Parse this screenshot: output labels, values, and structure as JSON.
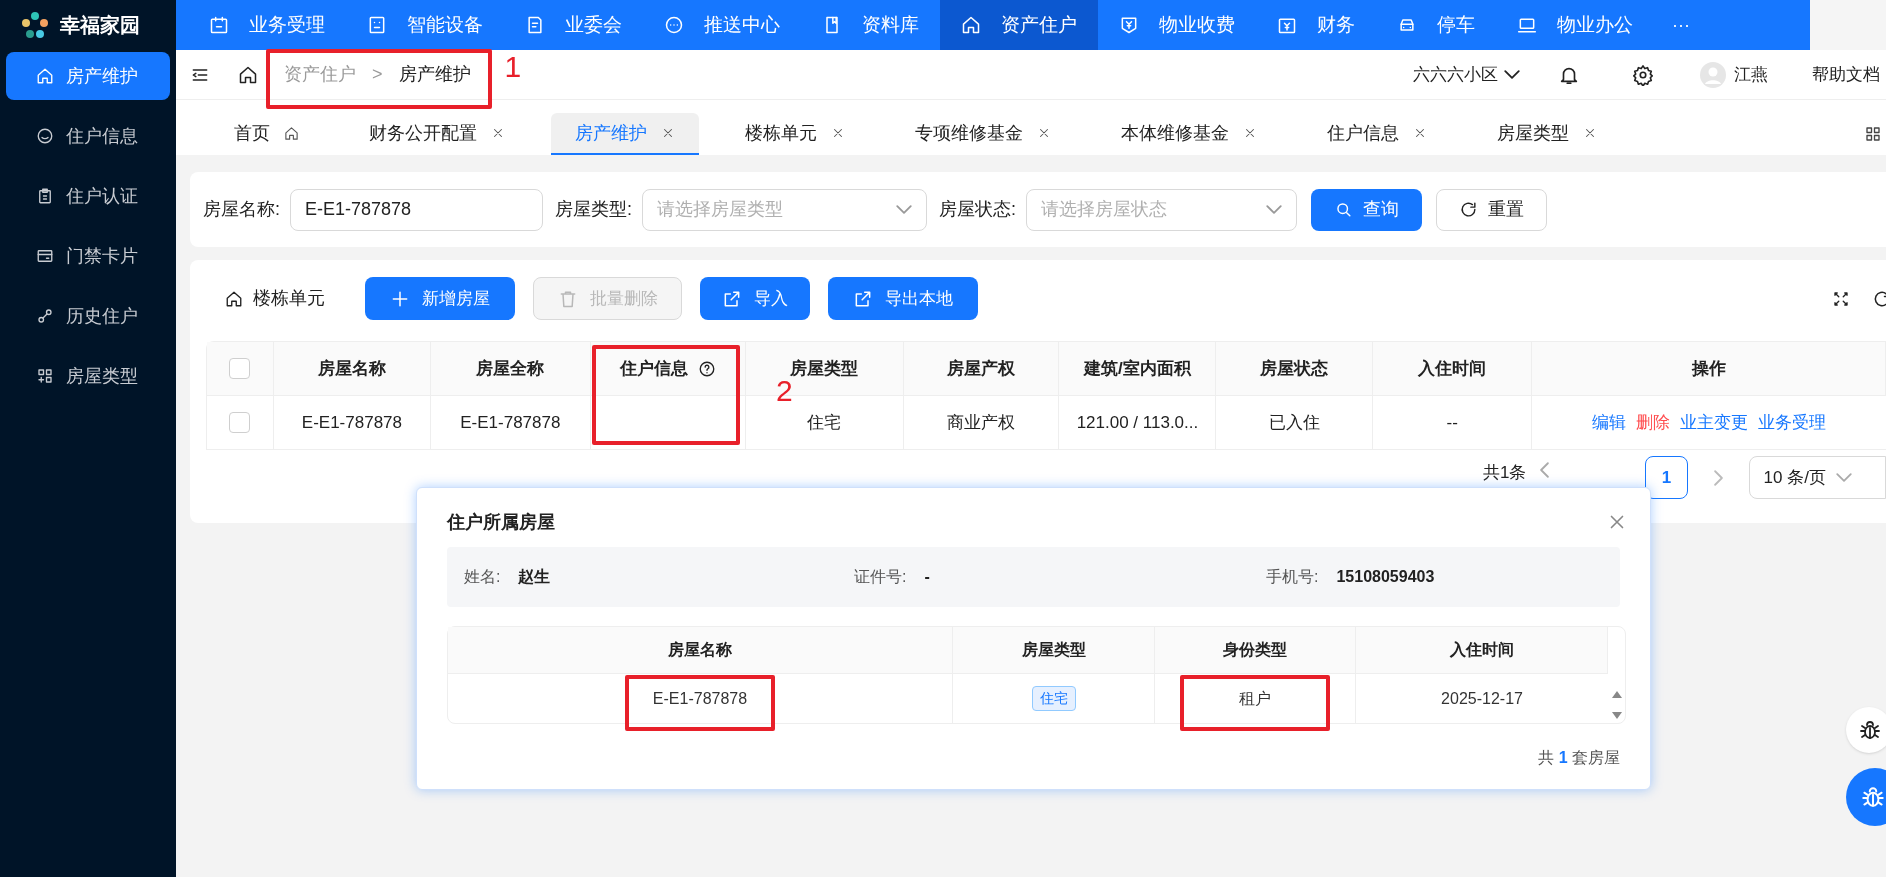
{
  "logo": {
    "text": "幸福家园"
  },
  "top_nav": [
    {
      "label": "业务受理",
      "selected": false
    },
    {
      "label": "智能设备",
      "selected": false
    },
    {
      "label": "业委会",
      "selected": false
    },
    {
      "label": "推送中心",
      "selected": false
    },
    {
      "label": "资料库",
      "selected": false
    },
    {
      "label": "资产住户",
      "selected": true
    },
    {
      "label": "物业收费",
      "selected": false
    },
    {
      "label": "财务",
      "selected": false
    },
    {
      "label": "停车",
      "selected": false
    },
    {
      "label": "物业办公",
      "selected": false
    }
  ],
  "top_nav_more": "···",
  "sidebar": {
    "items": [
      {
        "label": "房产维护",
        "selected": true
      },
      {
        "label": "住户信息",
        "selected": false
      },
      {
        "label": "住户认证",
        "selected": false
      },
      {
        "label": "门禁卡片",
        "selected": false
      },
      {
        "label": "历史住户",
        "selected": false
      },
      {
        "label": "房屋类型",
        "selected": false
      }
    ]
  },
  "header": {
    "breadcrumb": {
      "items": [
        "资产住户",
        "房产维护"
      ],
      "separator": ">",
      "highlighted": true,
      "annotation": "1"
    },
    "community": "六六六小区",
    "user_name": "江燕",
    "help": "帮助文档"
  },
  "tabs": [
    {
      "label": "首页",
      "kind": "home",
      "selected": false
    },
    {
      "label": "财务公开配置",
      "kind": "page",
      "selected": false
    },
    {
      "label": "房产维护",
      "kind": "page",
      "selected": true
    },
    {
      "label": "楼栋单元",
      "kind": "page",
      "selected": false
    },
    {
      "label": "专项维修基金",
      "kind": "page",
      "selected": false
    },
    {
      "label": "本体维修基金",
      "kind": "page",
      "selected": false
    },
    {
      "label": "住户信息",
      "kind": "page",
      "selected": false
    },
    {
      "label": "房屋类型",
      "kind": "page",
      "selected": false
    }
  ],
  "filters": [
    {
      "label": "房屋名称:",
      "kind": "input",
      "value": "E-E1-787878"
    },
    {
      "label": "房屋类型:",
      "kind": "select",
      "placeholder": "请选择房屋类型"
    },
    {
      "label": "房屋状态:",
      "kind": "select",
      "placeholder": "请选择房屋状态"
    }
  ],
  "filter_buttons": [
    {
      "label": "查询",
      "kind": "primary"
    },
    {
      "label": "重置",
      "kind": "default"
    }
  ],
  "toolbar": {
    "title": "楼栋单元",
    "buttons": [
      {
        "label": "新增房屋",
        "kind": "add",
        "disabled": false
      },
      {
        "label": "批量删除",
        "kind": "delete",
        "disabled": true
      },
      {
        "label": "导入",
        "kind": "import",
        "disabled": false
      },
      {
        "label": "导出本地",
        "kind": "export",
        "disabled": false
      }
    ]
  },
  "table": {
    "select_all_checked": false,
    "columns": [
      {
        "label": "房屋名称",
        "help": false,
        "highlighted": false
      },
      {
        "label": "房屋全称",
        "help": false,
        "highlighted": false
      },
      {
        "label": "住户信息",
        "help": true,
        "highlighted": true,
        "annotation": "2"
      },
      {
        "label": "房屋类型",
        "help": false,
        "highlighted": false
      },
      {
        "label": "房屋产权",
        "help": false,
        "highlighted": false
      },
      {
        "label": "建筑/室内面积",
        "help": false,
        "highlighted": false
      },
      {
        "label": "房屋状态",
        "help": false,
        "highlighted": false
      },
      {
        "label": "入住时间",
        "help": false,
        "highlighted": false
      },
      {
        "label": "操作",
        "help": false,
        "highlighted": false
      }
    ],
    "rows": [
      {
        "checked": false,
        "house_name": "E-E1-787878",
        "full_name": "E-E1-787878",
        "house_type": "住宅",
        "property_right": "商业产权",
        "area": "121.00 / 113.0...",
        "status": "已入住",
        "move_in": "--",
        "actions": [
          {
            "label": "编辑",
            "kind": "link"
          },
          {
            "label": "删除",
            "kind": "danger"
          },
          {
            "label": "业主变更",
            "kind": "link"
          },
          {
            "label": "业务受理",
            "kind": "link"
          }
        ]
      }
    ]
  },
  "pagination": {
    "total": "共1条",
    "pages": [
      {
        "label": "1",
        "selected": true
      }
    ],
    "page_size": "10 条/页"
  },
  "modal": {
    "title": "住户所属房屋",
    "info": [
      {
        "label": "姓名:",
        "value": "赵生"
      },
      {
        "label": "证件号:",
        "value": "-"
      },
      {
        "label": "手机号:",
        "value": "15108059403"
      }
    ],
    "columns": [
      "房屋名称",
      "房屋类型",
      "身份类型",
      "入住时间"
    ],
    "rows": [
      {
        "house_name": "E-E1-787878",
        "house_name_highlighted": true,
        "house_type": "住宅",
        "identity": "租户",
        "identity_highlighted": true,
        "move_in": "2025-12-17"
      }
    ],
    "footer": "共 **1** 套房屋"
  }
}
